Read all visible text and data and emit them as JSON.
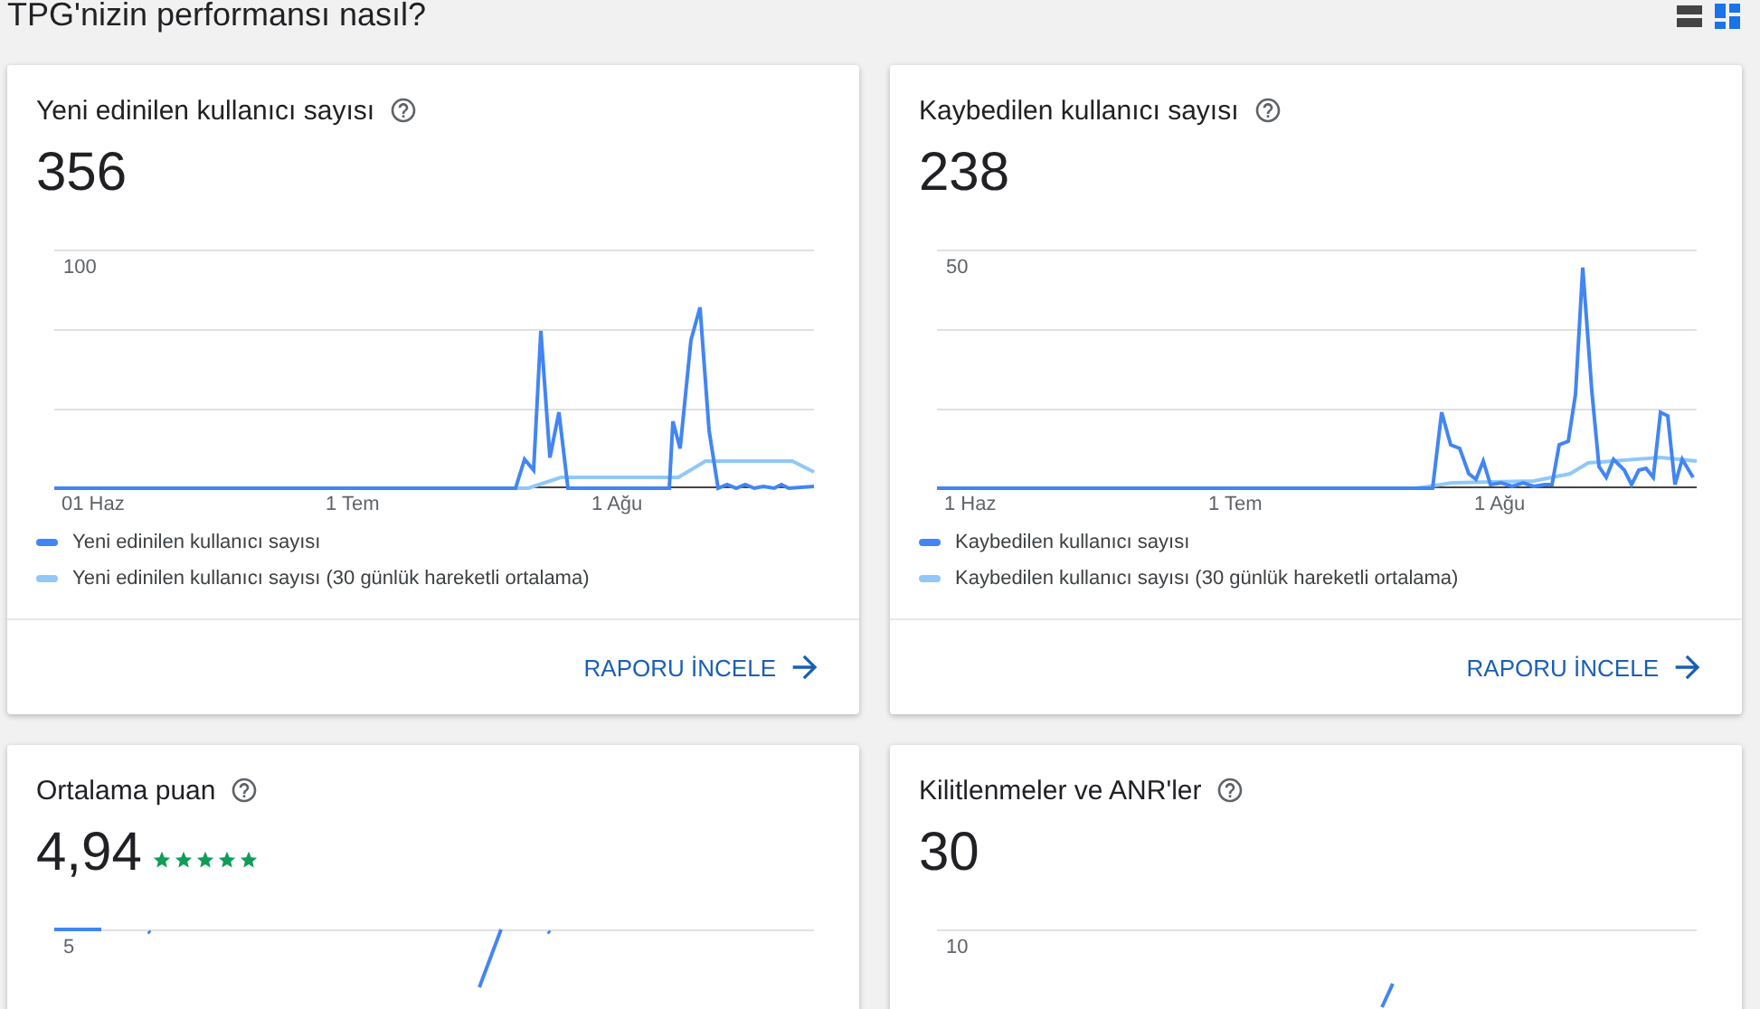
{
  "page_title": "TPG'nizin performansı nasıl?",
  "view_options": [
    {
      "kind": "list",
      "selected": false
    },
    {
      "kind": "grid",
      "selected": true
    }
  ],
  "cards": [
    {
      "title": "Yeni edinilen kullanıcı sayısı",
      "value": "356",
      "y_tick": "100",
      "x_labels": [
        "01 Haz",
        "1 Tem",
        "1 Ağu"
      ],
      "legend": [
        {
          "label": "Yeni edinilen kullanıcı sayısı",
          "color": "#4285f4"
        },
        {
          "label": "Yeni edinilen kullanıcı sayısı (30 günlük hareketli ortalama)",
          "color": "#90c8f8"
        }
      ],
      "action": "RAPORU İNCELE"
    },
    {
      "title": "Kaybedilen kullanıcı sayısı",
      "value": "238",
      "y_tick": "50",
      "x_labels": [
        "1 Haz",
        "1 Tem",
        "1 Ağu"
      ],
      "legend": [
        {
          "label": "Kaybedilen kullanıcı sayısı",
          "color": "#4285f4"
        },
        {
          "label": "Kaybedilen kullanıcı sayısı (30 günlük hareketli ortalama)",
          "color": "#90c8f8"
        }
      ],
      "action": "RAPORU İNCELE"
    },
    {
      "title": "Ortalama puan",
      "value": "4,94",
      "stars": 5,
      "y_tick": "5"
    },
    {
      "title": "Kilitlenmeler ve ANR'ler",
      "value": "30",
      "y_tick": "10"
    }
  ]
}
